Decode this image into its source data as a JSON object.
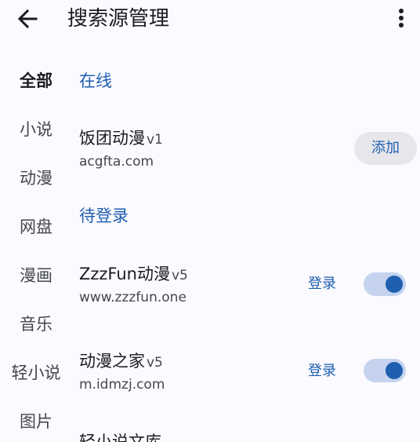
{
  "appbar": {
    "title": "搜索源管理",
    "back_icon": "arrow-left-icon",
    "menu_icon": "more-vertical-icon"
  },
  "rail": {
    "items": [
      "全部",
      "小说",
      "动漫",
      "网盘",
      "漫画",
      "音乐",
      "轻小说",
      "图片"
    ],
    "active_index": 0
  },
  "sections": {
    "online": {
      "title": "在线",
      "sources": [
        {
          "name": "饭团动漫",
          "version": "v1",
          "domain": "acgfta.com",
          "action_label": "添加"
        }
      ]
    },
    "pending_login": {
      "title": "待登录",
      "sources": [
        {
          "name": "ZzzFun动漫",
          "version": "v5",
          "domain": "www.zzzfun.one",
          "login_label": "登录",
          "enabled": true
        },
        {
          "name": "动漫之家",
          "version": "v5",
          "domain": "m.idmzj.com",
          "login_label": "登录",
          "enabled": true
        }
      ]
    },
    "partial_item": "轻小说文库"
  },
  "colors": {
    "accent": "#1f5fb0",
    "background": "#fbfaff",
    "toggle_track": "#c5d3ee"
  }
}
